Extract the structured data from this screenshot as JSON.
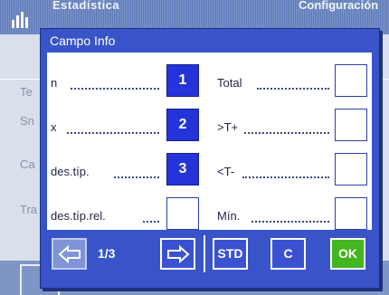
{
  "background": {
    "title": "Estadística",
    "title_right": "Configuración",
    "rows": [
      "Te",
      "Sn",
      "Ca",
      "Tra"
    ]
  },
  "dialog": {
    "title": "Campo Info",
    "left_fields": [
      {
        "label": "n",
        "value": "1",
        "selected": true
      },
      {
        "label": "x",
        "value": "2",
        "selected": true
      },
      {
        "label": "des.típ.",
        "value": "3",
        "selected": true
      },
      {
        "label": "des.típ.rel.",
        "value": "",
        "selected": false
      }
    ],
    "right_fields": [
      {
        "label": "Total",
        "value": "",
        "selected": false
      },
      {
        "label": ">T+",
        "value": "",
        "selected": false
      },
      {
        "label": "<T-",
        "value": "",
        "selected": false
      },
      {
        "label": "Mín.",
        "value": "",
        "selected": false
      }
    ]
  },
  "footer": {
    "page_indicator": "1/3",
    "std_label": "STD",
    "c_label": "C",
    "ok_label": "OK",
    "prev_icon": "arrow-left-icon",
    "next_icon": "arrow-right-icon"
  },
  "colors": {
    "dialog": "#3953c8",
    "selected_field": "#2434d8",
    "ok_button": "#43b51e"
  }
}
